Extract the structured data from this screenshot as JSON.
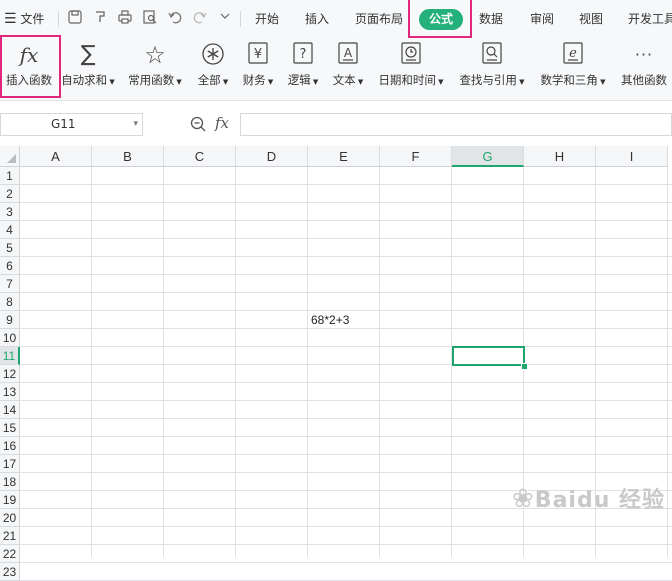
{
  "menubar": {
    "menu_label": "文件",
    "tabs": [
      "开始",
      "插入",
      "页面布局",
      "公式",
      "数据",
      "审阅",
      "视图",
      "开发工具"
    ],
    "active_tab": "公式"
  },
  "ribbon": {
    "buttons": [
      {
        "label": "插入函数",
        "icon": "fx-icon"
      },
      {
        "label": "自动求和",
        "icon": "sigma-icon"
      },
      {
        "label": "常用函数",
        "icon": "star-icon"
      },
      {
        "label": "全部",
        "icon": "asterisk-circle-icon"
      },
      {
        "label": "财务",
        "icon": "yen-icon"
      },
      {
        "label": "逻辑",
        "icon": "question-box-icon"
      },
      {
        "label": "文本",
        "icon": "text-a-icon"
      },
      {
        "label": "日期和时间",
        "icon": "clock-icon"
      },
      {
        "label": "查找与引用",
        "icon": "search-doc-icon"
      },
      {
        "label": "数学和三角",
        "icon": "theta-icon"
      },
      {
        "label": "其他函数",
        "icon": "more-icon"
      }
    ],
    "fx_symbol": "fx",
    "sigma_symbol": "∑",
    "star_symbol": "☆",
    "asterisk_symbol": "✻",
    "yen_symbol": "¥",
    "question_symbol": "?",
    "a_symbol": "A",
    "theta_symbol": "e",
    "more_symbol": "···"
  },
  "formula_bar": {
    "name_box_value": "G11",
    "fx_label": "fx",
    "formula_value": ""
  },
  "sheet": {
    "columns": [
      "A",
      "B",
      "C",
      "D",
      "E",
      "F",
      "G",
      "H",
      "I"
    ],
    "selected_column": "G",
    "rows": [
      "1",
      "2",
      "3",
      "4",
      "5",
      "6",
      "7",
      "8",
      "9",
      "10",
      "11",
      "12",
      "13",
      "14",
      "15",
      "16",
      "17",
      "18",
      "19",
      "20",
      "21",
      "22",
      "23"
    ],
    "selected_row": "11",
    "cells": {
      "E9": "68*2+3"
    }
  },
  "watermark": {
    "text": "Baidu 经验"
  },
  "colors": {
    "accent": "#23b07a",
    "highlight_box": "#e0287a"
  }
}
